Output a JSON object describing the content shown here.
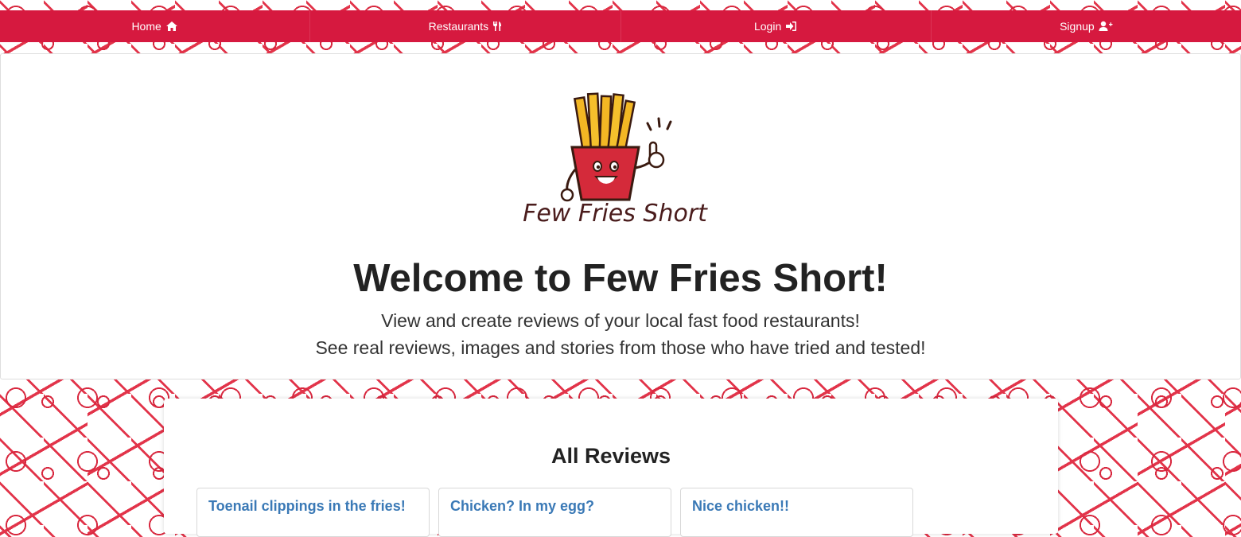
{
  "nav": {
    "items": [
      {
        "label": "Home",
        "icon": "home-icon"
      },
      {
        "label": "Restaurants",
        "icon": "utensils-icon"
      },
      {
        "label": "Login",
        "icon": "sign-in-icon"
      },
      {
        "label": "Signup",
        "icon": "user-plus-icon"
      }
    ]
  },
  "logo": {
    "text": "Few Fries Short"
  },
  "hero": {
    "title": "Welcome to Few Fries Short!",
    "line1": "View and create reviews of your local fast food restaurants!",
    "line2": "See real reviews, images and stories from those who have tried and tested!"
  },
  "reviews": {
    "heading": "All Reviews",
    "items": [
      {
        "title": "Toenail clippings in the fries!"
      },
      {
        "title": "Chicken? In my egg?"
      },
      {
        "title": "Nice chicken!!"
      }
    ]
  },
  "colors": {
    "brand": "#d6193f",
    "link": "#3a79b6",
    "logo_text": "#4a1c1c"
  }
}
